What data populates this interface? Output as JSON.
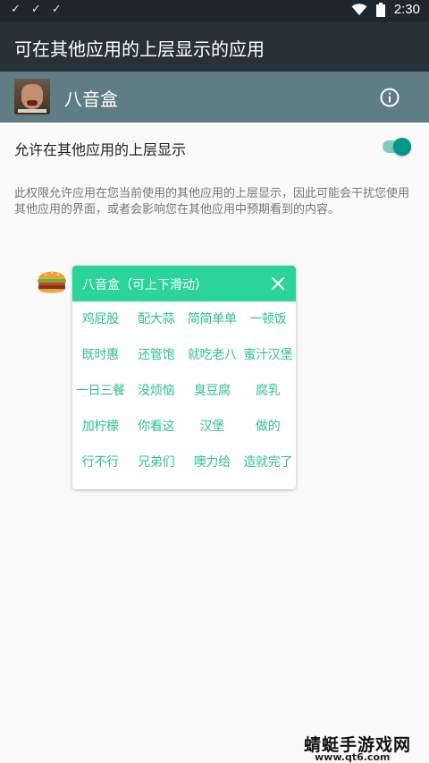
{
  "status_bar": {
    "notification_icons": [
      "check-icon",
      "check-icon",
      "check-icon"
    ],
    "time": "2:30"
  },
  "app_bar": {
    "title": "可在其他应用的上层显示的应用"
  },
  "app_row": {
    "name": "八音盒"
  },
  "permission": {
    "label": "允许在其他应用的上层显示",
    "enabled": true,
    "description": "此权限允许应用在您当前使用的其他应用的上层显示，因此可能会干扰您使用其他应用的界面，或者会影响您在其他应用中预期看到的内容。"
  },
  "popup": {
    "title": "八音盒（可上下滑动）",
    "items": [
      [
        "鸡屁股",
        "配大蒜",
        "简简单单",
        "一顿饭"
      ],
      [
        "既时惠",
        "还管饱",
        "就吃老八",
        "蜜汁汉堡"
      ],
      [
        "一日三餐",
        "没烦恼",
        "臭豆腐",
        "腐乳"
      ],
      [
        "加柠檬",
        "你看这",
        "汉堡",
        "做的"
      ],
      [
        "行不行",
        "兄弟们",
        "噢力给",
        "造就完了"
      ]
    ]
  },
  "watermark": {
    "main": "蜻蜓手游戏网",
    "sub": "www.qt6.com"
  },
  "colors": {
    "status_bar": "#1e272c",
    "app_bar": "#263238",
    "app_row": "#607d85",
    "toggle_accent": "#009688",
    "popup_header": "#2ad49a",
    "popup_item_text": "#2ec18e"
  }
}
